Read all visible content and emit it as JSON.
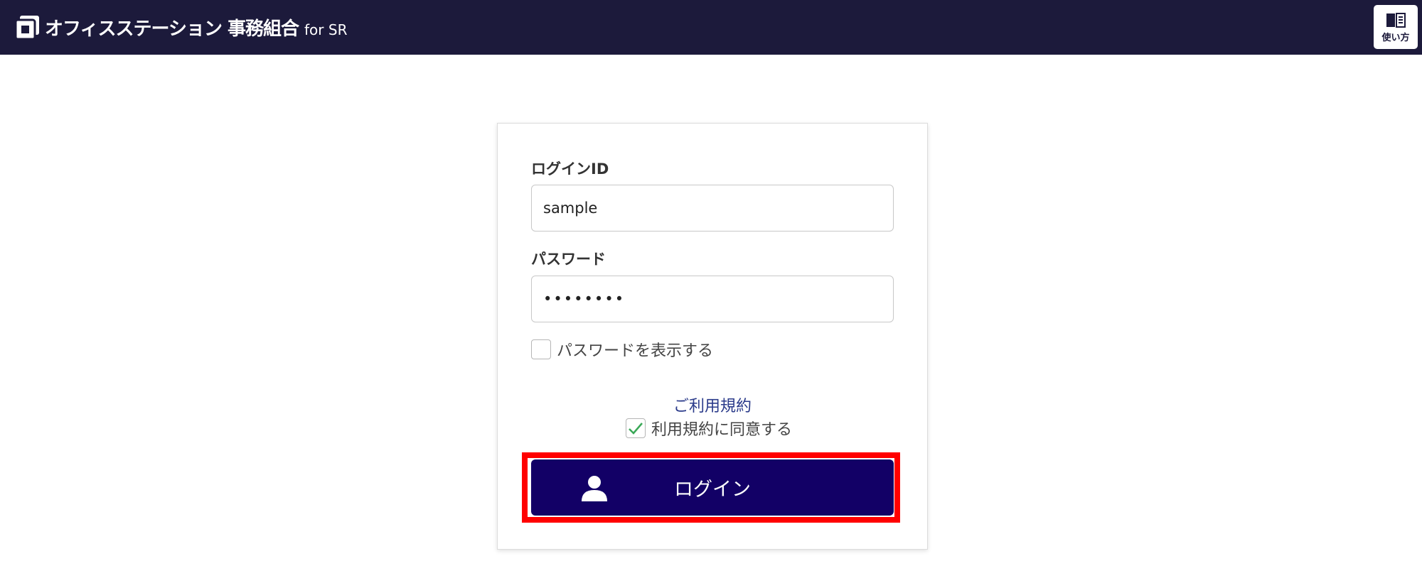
{
  "header": {
    "brand_name": "オフィスステーション 事務組合",
    "brand_sub": "for SR",
    "help_label": "使い方",
    "background": "#1c1a3b"
  },
  "form": {
    "login_id_label": "ログインID",
    "login_id_value": "sample",
    "password_label": "パスワード",
    "password_value": "••••••••",
    "show_password_label": "パスワードを表示する",
    "show_password_checked": false,
    "terms_link": "ご利用規約",
    "agree_terms_label": "利用規約に同意する",
    "agree_terms_checked": true,
    "login_button_label": "ログイン"
  },
  "colors": {
    "login_button": "#120066",
    "highlight": "#ff0000",
    "link": "#2a3a8a",
    "check": "#3aa857"
  },
  "icons": {
    "brand": "brand-logo-icon",
    "help": "book-icon",
    "login": "user-icon",
    "check": "checkmark-icon"
  }
}
